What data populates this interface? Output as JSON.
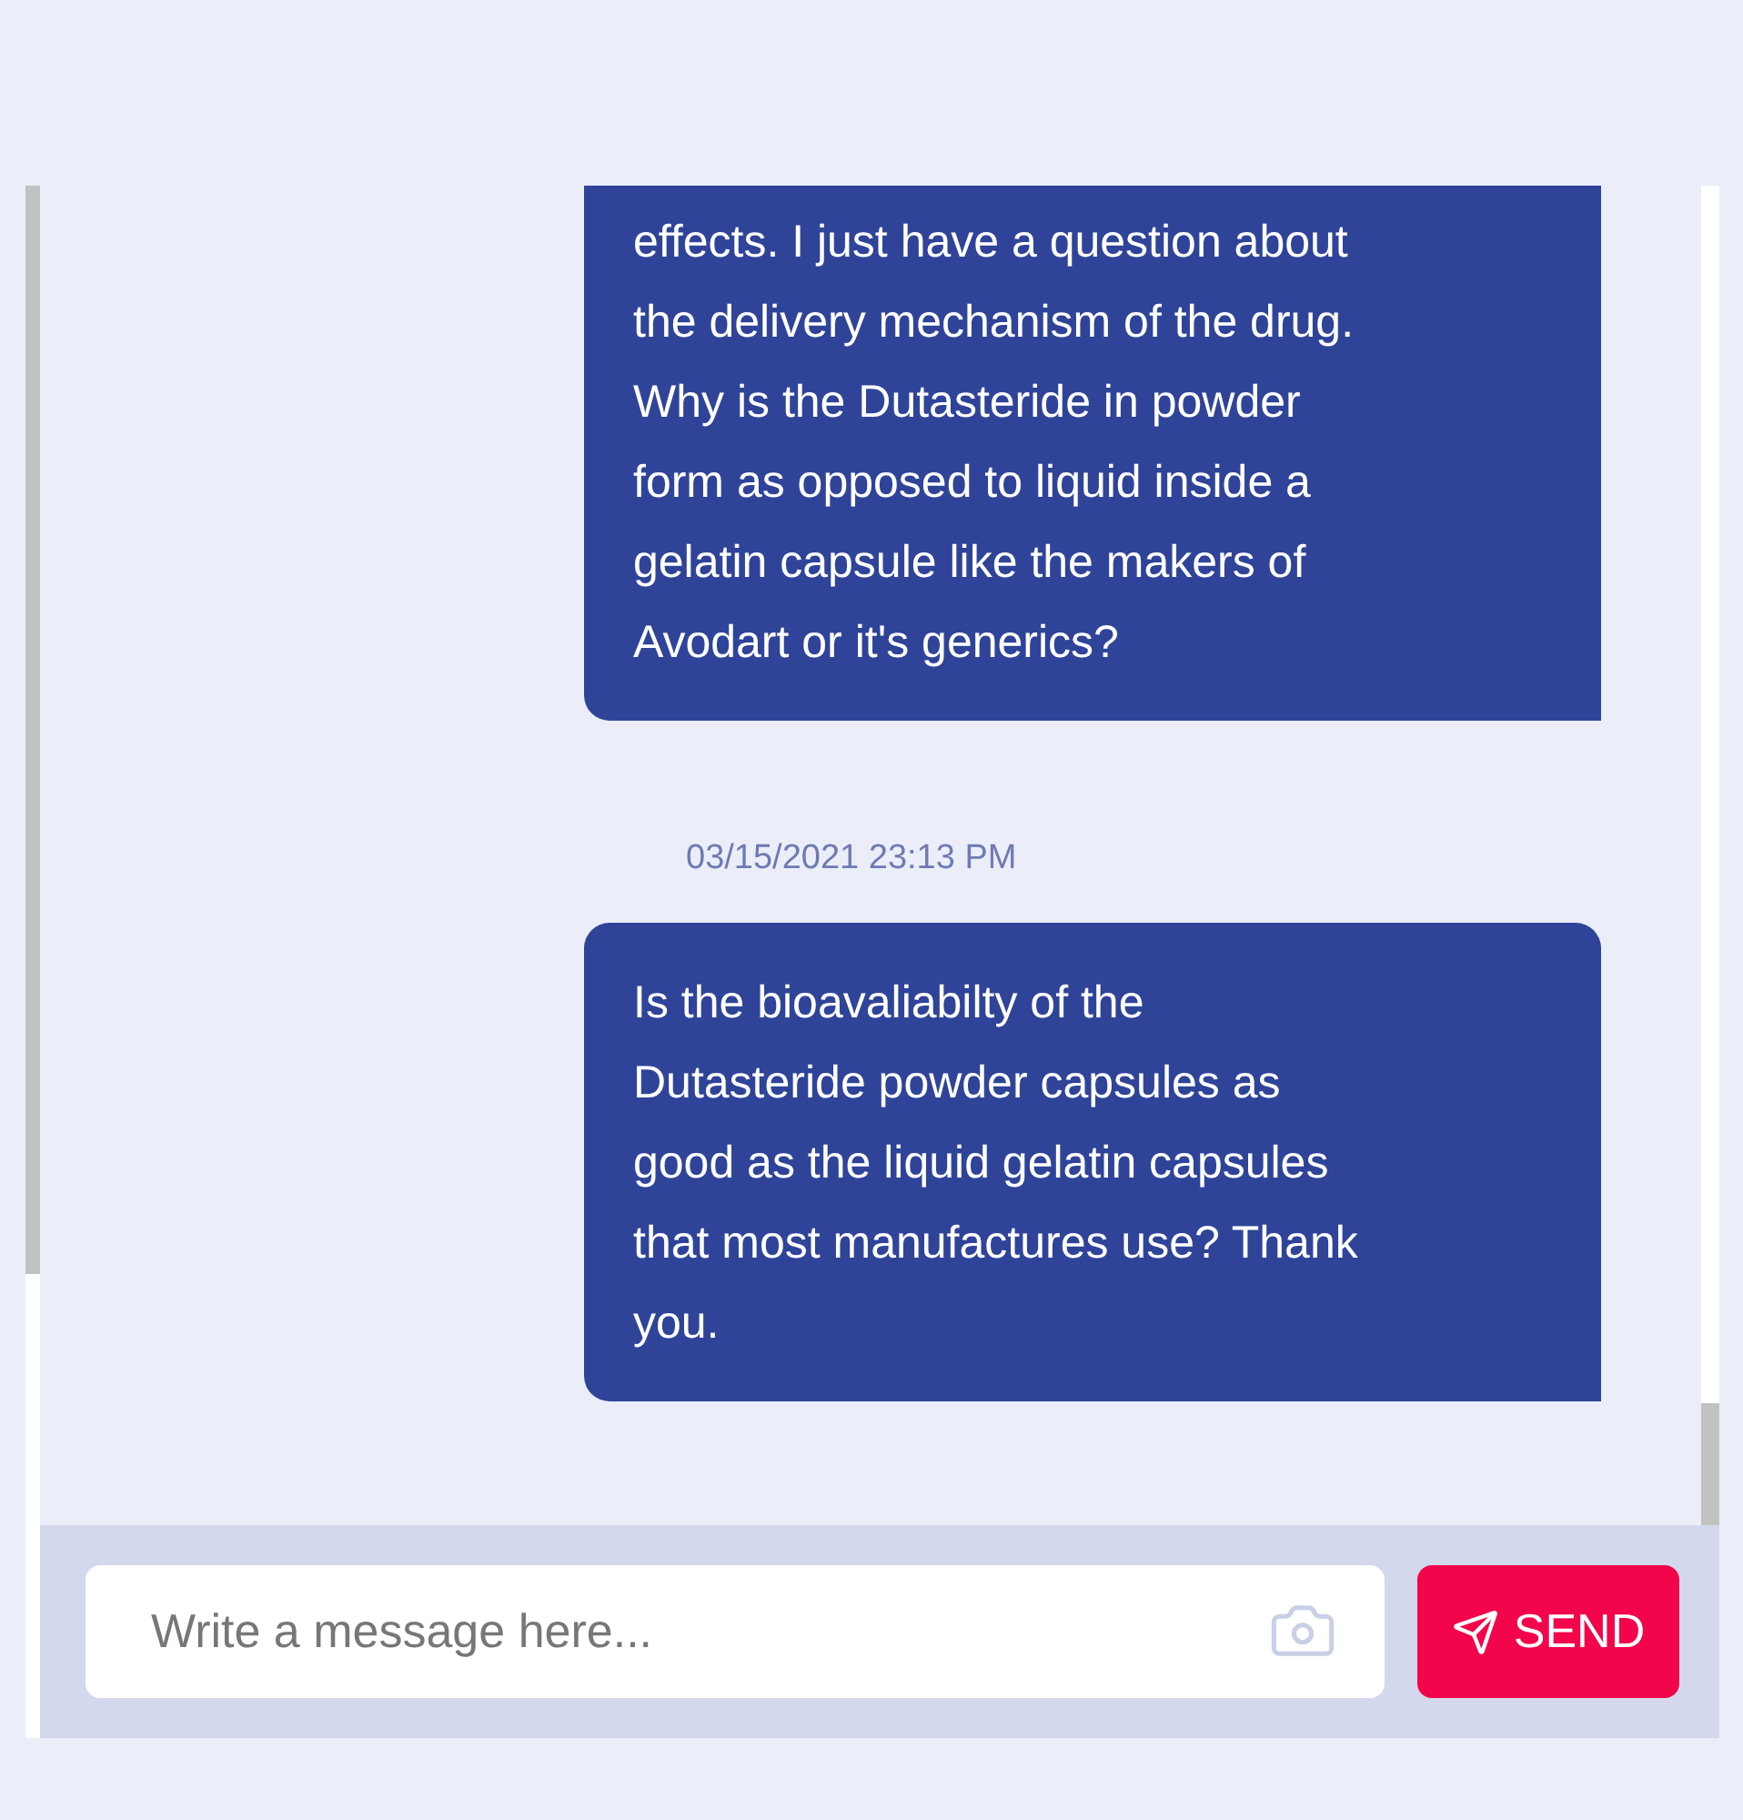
{
  "messages": [
    {
      "kind": "outgoing",
      "cut_top": true,
      "lines": [
        "effects. I just have a question about",
        "the delivery mechanism of the drug.",
        "Why is the Dutasteride in powder",
        "form as opposed to liquid inside a",
        "gelatin capsule like the makers of",
        "Avodart or it's generics?"
      ]
    },
    {
      "kind": "timestamp",
      "text": "03/15/2021 23:13 PM"
    },
    {
      "kind": "outgoing",
      "cut_top": false,
      "lines": [
        "Is the bioavaliabilty of the",
        "Dutasteride powder capsules as",
        "good as the liquid gelatin capsules",
        "that most manufactures use? Thank",
        "you."
      ]
    }
  ],
  "composer": {
    "placeholder": "Write a message here...",
    "send_label": "SEND"
  }
}
